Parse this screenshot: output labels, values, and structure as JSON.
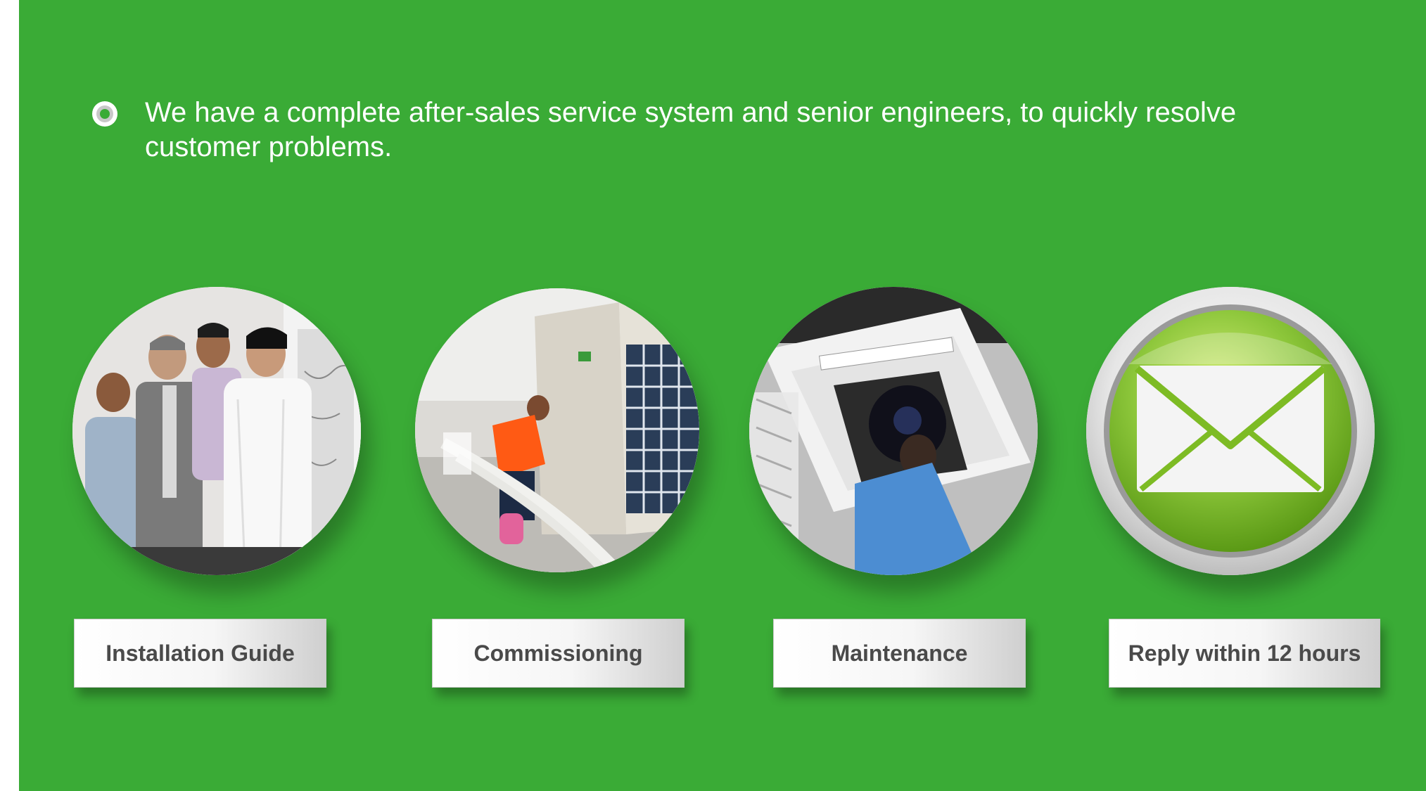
{
  "intro": {
    "text": "We have a complete after-sales service system and senior engineers, to quickly resolve customer problems."
  },
  "services": [
    {
      "label": "Installation Guide",
      "icon": "people-meeting-photo"
    },
    {
      "label": "Commissioning",
      "icon": "outdoor-unit-photo"
    },
    {
      "label": "Maintenance",
      "icon": "cassette-ac-repair-photo"
    },
    {
      "label": "Reply within 12 hours",
      "icon": "mail-icon"
    }
  ],
  "colors": {
    "background": "#3aab36",
    "label_text": "#4a4a4a",
    "envelope_green": "#7dbb24"
  }
}
